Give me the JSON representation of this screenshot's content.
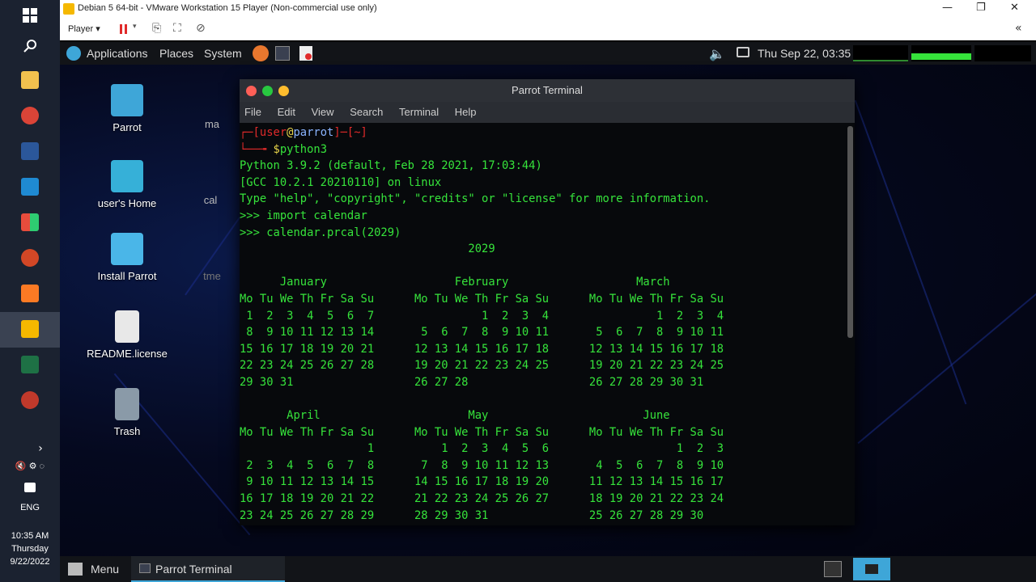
{
  "host_taskbar": {
    "language": "ENG",
    "time": "10:35 AM",
    "day": "Thursday",
    "date": "9/22/2022"
  },
  "vmware": {
    "title": "Debian 5 64-bit - VMware Workstation 15 Player (Non-commercial use only)",
    "player_menu": "Player"
  },
  "top_panel": {
    "applications": "Applications",
    "places": "Places",
    "system": "System",
    "clock": "Thu Sep 22, 03:35"
  },
  "desktop": {
    "icons": [
      {
        "label": "Parrot",
        "color": "#3ea6d8"
      },
      {
        "label": "user's Home",
        "color": "#36b0d8"
      },
      {
        "label": "Install Parrot",
        "color": "#4ab6e8"
      },
      {
        "label": "README.license",
        "color": "#e8e8e8"
      },
      {
        "label": "Trash",
        "color": "#8a9aa8"
      }
    ],
    "partial_labels": [
      "ma",
      "cal",
      "tme"
    ]
  },
  "terminal": {
    "title": "Parrot Terminal",
    "menu": [
      "File",
      "Edit",
      "View",
      "Search",
      "Terminal",
      "Help"
    ],
    "prompt_user": "user",
    "prompt_at": "@",
    "prompt_host": "parrot",
    "prompt_dir": "~",
    "command1": "python3",
    "output_lines": [
      "Python 3.9.2 (default, Feb 28 2021, 17:03:44)",
      "[GCC 10.2.1 20210110] on linux",
      "Type \"help\", \"copyright\", \"credits\" or \"license\" for more information.",
      ">>> import calendar",
      ">>> calendar.prcal(2029)",
      "                                  2029",
      "",
      "      January                   February                   March",
      "Mo Tu We Th Fr Sa Su      Mo Tu We Th Fr Sa Su      Mo Tu We Th Fr Sa Su",
      " 1  2  3  4  5  6  7                1  2  3  4                1  2  3  4",
      " 8  9 10 11 12 13 14       5  6  7  8  9 10 11       5  6  7  8  9 10 11",
      "15 16 17 18 19 20 21      12 13 14 15 16 17 18      12 13 14 15 16 17 18",
      "22 23 24 25 26 27 28      19 20 21 22 23 24 25      19 20 21 22 23 24 25",
      "29 30 31                  26 27 28                  26 27 28 29 30 31",
      "",
      "       April                      May                       June",
      "Mo Tu We Th Fr Sa Su      Mo Tu We Th Fr Sa Su      Mo Tu We Th Fr Sa Su",
      "                   1          1  2  3  4  5  6                   1  2  3",
      " 2  3  4  5  6  7  8       7  8  9 10 11 12 13       4  5  6  7  8  9 10",
      " 9 10 11 12 13 14 15      14 15 16 17 18 19 20      11 12 13 14 15 16 17",
      "16 17 18 19 20 21 22      21 22 23 24 25 26 27      18 19 20 21 22 23 24",
      "23 24 25 26 27 28 29      28 29 30 31               25 26 27 28 29 30"
    ]
  },
  "bottom_panel": {
    "menu": "Menu",
    "task": "Parrot Terminal"
  }
}
